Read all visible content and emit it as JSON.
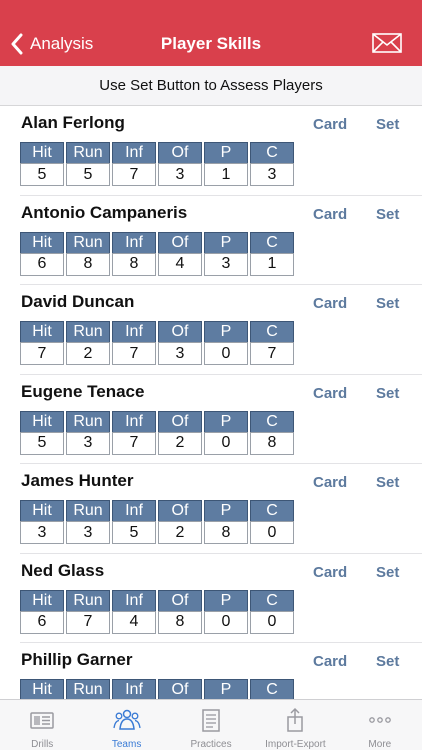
{
  "nav": {
    "back_label": "Analysis",
    "title": "Player Skills",
    "icons": {
      "back": "chevron-left-icon",
      "mail": "mail-icon"
    }
  },
  "subheader": "Use Set Button to Assess Players",
  "skill_labels": [
    "Hit",
    "Run",
    "Inf",
    "Of",
    "P",
    "C"
  ],
  "card_label": "Card",
  "set_label": "Set",
  "players": [
    {
      "name": "Alan Ferlong",
      "scores": [
        "5",
        "5",
        "7",
        "3",
        "1",
        "3"
      ]
    },
    {
      "name": "Antonio Campaneris",
      "scores": [
        "6",
        "8",
        "8",
        "4",
        "3",
        "1"
      ]
    },
    {
      "name": "David Duncan",
      "scores": [
        "7",
        "2",
        "7",
        "3",
        "0",
        "7"
      ]
    },
    {
      "name": "Eugene Tenace",
      "scores": [
        "5",
        "3",
        "7",
        "2",
        "0",
        "8"
      ]
    },
    {
      "name": "James Hunter",
      "scores": [
        "3",
        "3",
        "5",
        "2",
        "8",
        "0"
      ]
    },
    {
      "name": "Ned Glass",
      "scores": [
        "6",
        "7",
        "4",
        "8",
        "0",
        "0"
      ]
    },
    {
      "name": "Phillip Garner",
      "scores": [
        "",
        "",
        "",
        "",
        "",
        ""
      ]
    }
  ],
  "tabs": [
    {
      "label": "Drills",
      "icon": "drills-icon",
      "active": false
    },
    {
      "label": "Teams",
      "icon": "teams-icon",
      "active": true
    },
    {
      "label": "Practices",
      "icon": "practices-icon",
      "active": false
    },
    {
      "label": "Import-Export",
      "icon": "share-icon",
      "active": false
    },
    {
      "label": "More",
      "icon": "more-icon",
      "active": false
    }
  ],
  "colors": {
    "nav_bg": "#d9404c",
    "skill_header": "#5e7ca1",
    "button_text": "#5d7a9e",
    "tab_active": "#3a7bd5",
    "tab_inactive": "#8e8e93"
  }
}
